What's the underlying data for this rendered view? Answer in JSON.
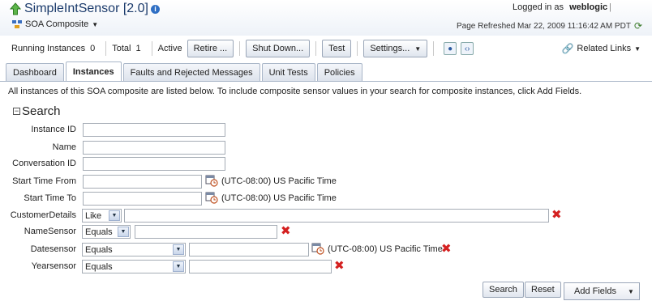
{
  "header": {
    "title": "SimpleIntSensor [2.0]",
    "composite_label": "SOA Composite",
    "logged_in_label": "Logged in as",
    "username": "weblogic",
    "refreshed": "Page Refreshed Mar 22, 2009 11:16:42 AM PDT"
  },
  "toolbar": {
    "running_label": "Running Instances",
    "running_count": "0",
    "total_label": "Total",
    "total_count": "1",
    "active_label": "Active",
    "retire": "Retire ...",
    "shutdown": "Shut Down...",
    "test": "Test",
    "settings": "Settings...",
    "related_links": "Related Links"
  },
  "tabs": [
    "Dashboard",
    "Instances",
    "Faults and Rejected Messages",
    "Unit Tests",
    "Policies"
  ],
  "description": "All instances of this SOA composite are listed below. To include composite sensor values in your search for composite instances, click Add Fields.",
  "search": {
    "heading": "Search",
    "instance_id": "Instance ID",
    "name": "Name",
    "conversation_id": "Conversation ID",
    "start_time_from": "Start Time From",
    "start_time_to": "Start Time To",
    "timezone": "(UTC-08:00) US Pacific Time",
    "customer_details": "CustomerDetails",
    "customer_op": "Like",
    "name_sensor": "NameSensor",
    "name_op": "Equals",
    "date_sensor": "Datesensor",
    "date_op": "Equals",
    "year_sensor": "Yearsensor",
    "year_op": "Equals"
  },
  "buttons": {
    "search": "Search",
    "reset": "Reset",
    "add_fields": "Add Fields"
  },
  "colors": {
    "title": "#1a3a6b",
    "remove": "#d42020"
  }
}
